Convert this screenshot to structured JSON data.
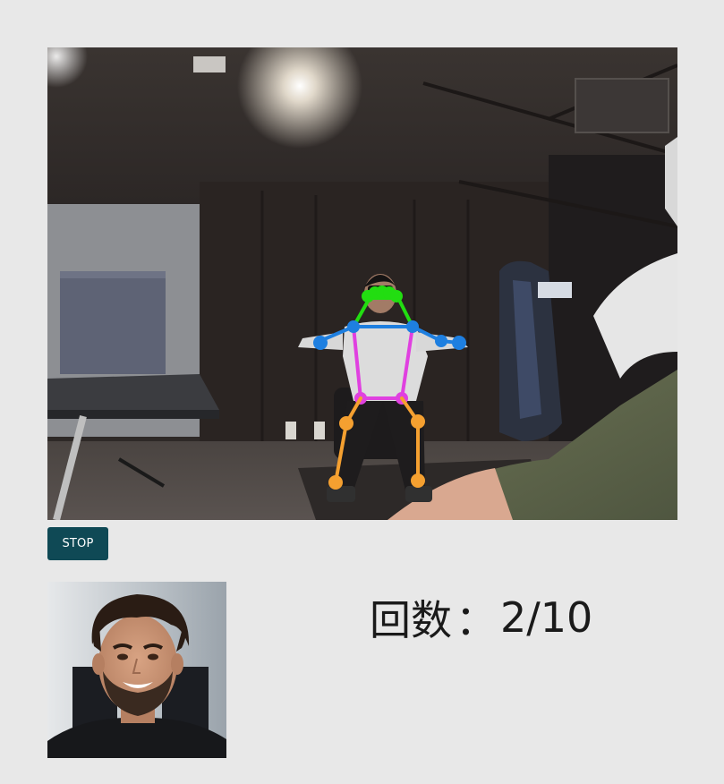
{
  "controls": {
    "stop_label": "STOP"
  },
  "counter": {
    "label": "回数",
    "separator": "：",
    "current": 2,
    "total": 10,
    "display": "2/10"
  },
  "colors": {
    "background": "#e8e8e8",
    "stop_button": "#0f4955",
    "pose_head": "#22dd11",
    "pose_arms": "#1e7fe0",
    "pose_torso": "#e040e0",
    "pose_legs": "#f5a030"
  }
}
